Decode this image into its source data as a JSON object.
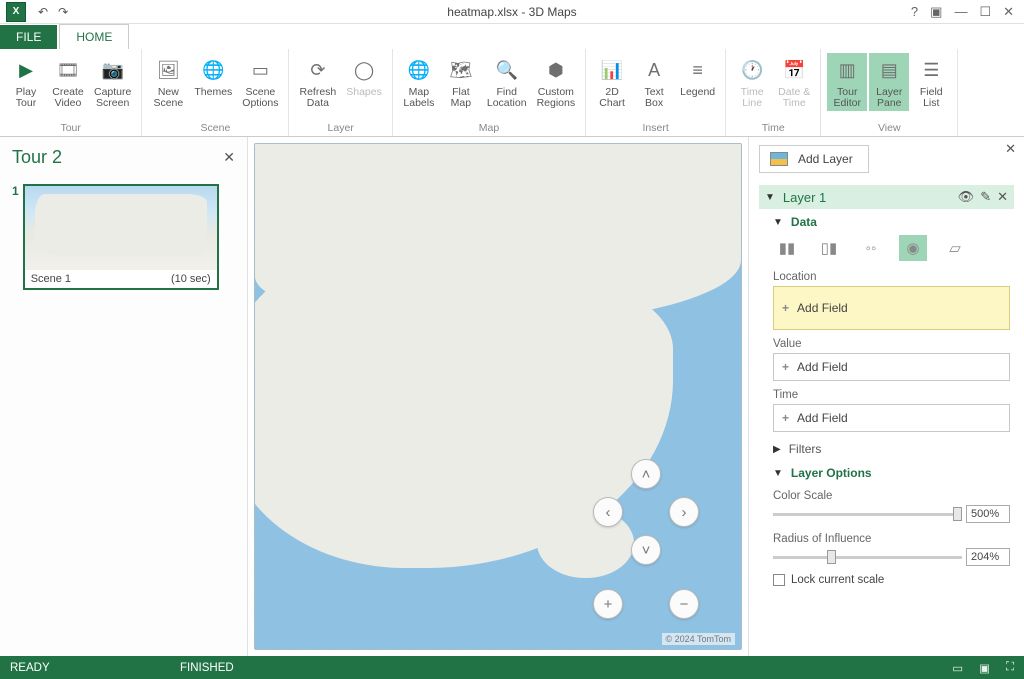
{
  "title": "heatmap.xlsx - 3D Maps",
  "tabs": {
    "file": "FILE",
    "home": "HOME"
  },
  "ribbon": {
    "tour": {
      "label": "Tour",
      "play": "Play\nTour",
      "create": "Create\nVideo",
      "capture": "Capture\nScreen"
    },
    "scene": {
      "label": "Scene",
      "new": "New\nScene",
      "themes": "Themes",
      "options": "Scene\nOptions"
    },
    "layer": {
      "label": "Layer",
      "refresh": "Refresh\nData",
      "shapes": "Shapes"
    },
    "map": {
      "label": "Map",
      "labels": "Map\nLabels",
      "flat": "Flat\nMap",
      "find": "Find\nLocation",
      "custom": "Custom\nRegions"
    },
    "insert": {
      "label": "Insert",
      "chart": "2D\nChart",
      "text": "Text\nBox",
      "legend": "Legend"
    },
    "time": {
      "label": "Time",
      "timeline": "Time\nLine",
      "datetime": "Date &\nTime"
    },
    "view": {
      "label": "View",
      "tour_editor": "Tour\nEditor",
      "layer_pane": "Layer\nPane",
      "field_list": "Field\nList"
    }
  },
  "tour_panel": {
    "title": "Tour 2",
    "scene_num": "1",
    "scene_name": "Scene 1",
    "scene_dur": "(10 sec)"
  },
  "map": {
    "credit": "© 2024 TomTom"
  },
  "layer_pane": {
    "add_layer": "Add Layer",
    "layer_name": "Layer 1",
    "data": "Data",
    "location": "Location",
    "value": "Value",
    "time": "Time",
    "add_field": "Add Field",
    "filters": "Filters",
    "layer_options": "Layer Options",
    "color_scale": "Color Scale",
    "color_scale_val": "500%",
    "radius": "Radius of Influence",
    "radius_val": "204%",
    "lock": "Lock current scale"
  },
  "status": {
    "ready": "READY",
    "finished": "FINISHED"
  }
}
